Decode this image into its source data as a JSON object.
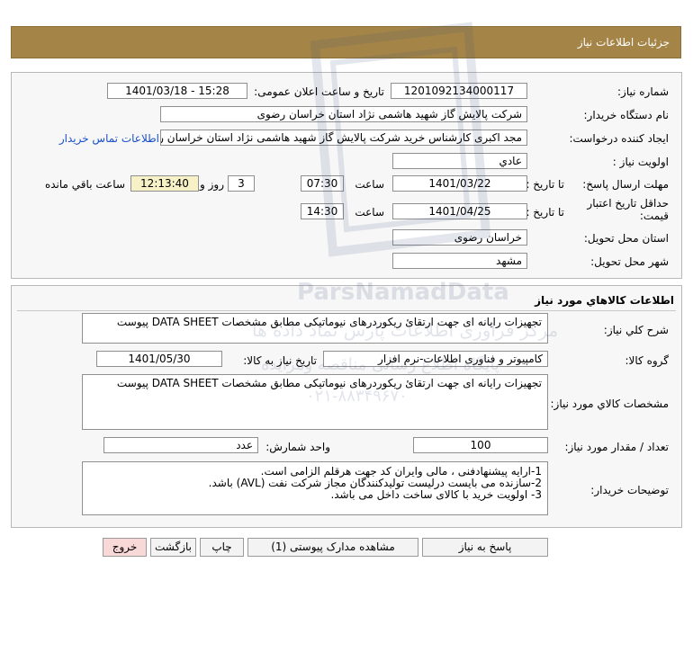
{
  "header": {
    "title": "جزئیات اطلاعات نیاز"
  },
  "info": {
    "need_number_label": "شماره نیاز:",
    "need_number": "1201092134000117",
    "announce_label": "تاریخ و ساعت اعلان عمومی:",
    "announce_value": "1401/03/18 - 15:28",
    "buyer_org_label": "نام دستگاه خريدار:",
    "buyer_org": "شرکت پالایش گاز شهید هاشمی نژاد   استان خراسان رضوی",
    "requester_label": "ایجاد کننده درخواست:",
    "requester": "مجد اکبری کارشناس خرید شرکت پالایش گاز شهید هاشمی نژاد   استان خراسان رضوی",
    "contact_link": "اطلاعات تماس خریدار",
    "priority_label": "اولويت نياز :",
    "priority": "عادي",
    "deadline_label": "مهلت ارسال پاسخ:",
    "to_date_label": "تا تاريخ :",
    "deadline_date": "1401/03/22",
    "time_label": "ساعت",
    "deadline_time": "07:30",
    "days": "3",
    "day_and_label": "روز و",
    "remaining_time": "12:13:40",
    "remaining_label": "ساعت باقي مانده",
    "validity_label": "حداقل تاريخ اعتبار قيمت:",
    "validity_date": "1401/04/25",
    "validity_time": "14:30",
    "province_label": "استان محل تحويل:",
    "province": "خراسان رضوی",
    "city_label": "شهر محل تحويل:",
    "city": "مشهد"
  },
  "goods": {
    "title": "اطلاعات كالاهاي مورد نياز",
    "general_desc_label": "شرح كلي نياز:",
    "general_desc": "تجهیزات رایانه ای جهت ارتقائ ریکوردرهای نیوماتیکی مطابق مشخصات DATA SHEET پیوست",
    "group_label": "گروه كالا:",
    "group": "کامپیوتر و فناوری اطلاعات-نرم افزار",
    "need_date_label": "تاریخ نیاز به کالا:",
    "need_date": "1401/05/30",
    "spec_label": "مشخصات كالاي مورد نياز:",
    "spec": "تجهیزات رایانه ای جهت ارتقائ ریکوردرهای نیوماتیکی مطابق مشخصات DATA SHEET پیوست",
    "qty_label": "تعداد / مقدار مورد نیاز:",
    "qty": "100",
    "unit_label": "واحد شمارش:",
    "unit": "عدد",
    "notes_label": "توضيحات خريدار:",
    "notes": [
      "1-ارایه پیشنهادفنی ، مالی وایران کد جهت هرقلم الزامی است.",
      "2-سازنده می بایست درلیست تولیدکنندگان مجاز شرکت نفت (AVL)  باشد.",
      "3- اولویت خرید  با کالای ساخت  داخل می باشد."
    ]
  },
  "buttons": {
    "reply": "پاسخ به نیاز",
    "attachments": "مشاهده مدارک پیوستی (1)",
    "print": "چاپ",
    "back": "بازگشت",
    "exit": "خروج"
  },
  "watermark": {
    "brand": "ParsNamadData",
    "line1": "مرکز فراوری اطلاعات پارس نماد داده ها",
    "line2": "پایگاه اطلاع رسانی مناقصه ومزایده",
    "phone": "۰۲۱-۸۸۳۴۹۶۷۰"
  },
  "colors": {
    "header_bg": "#a48547",
    "link": "#1a50c8",
    "remaining_bg": "#f6f1c6",
    "exit_bg": "#f9d8d8"
  }
}
